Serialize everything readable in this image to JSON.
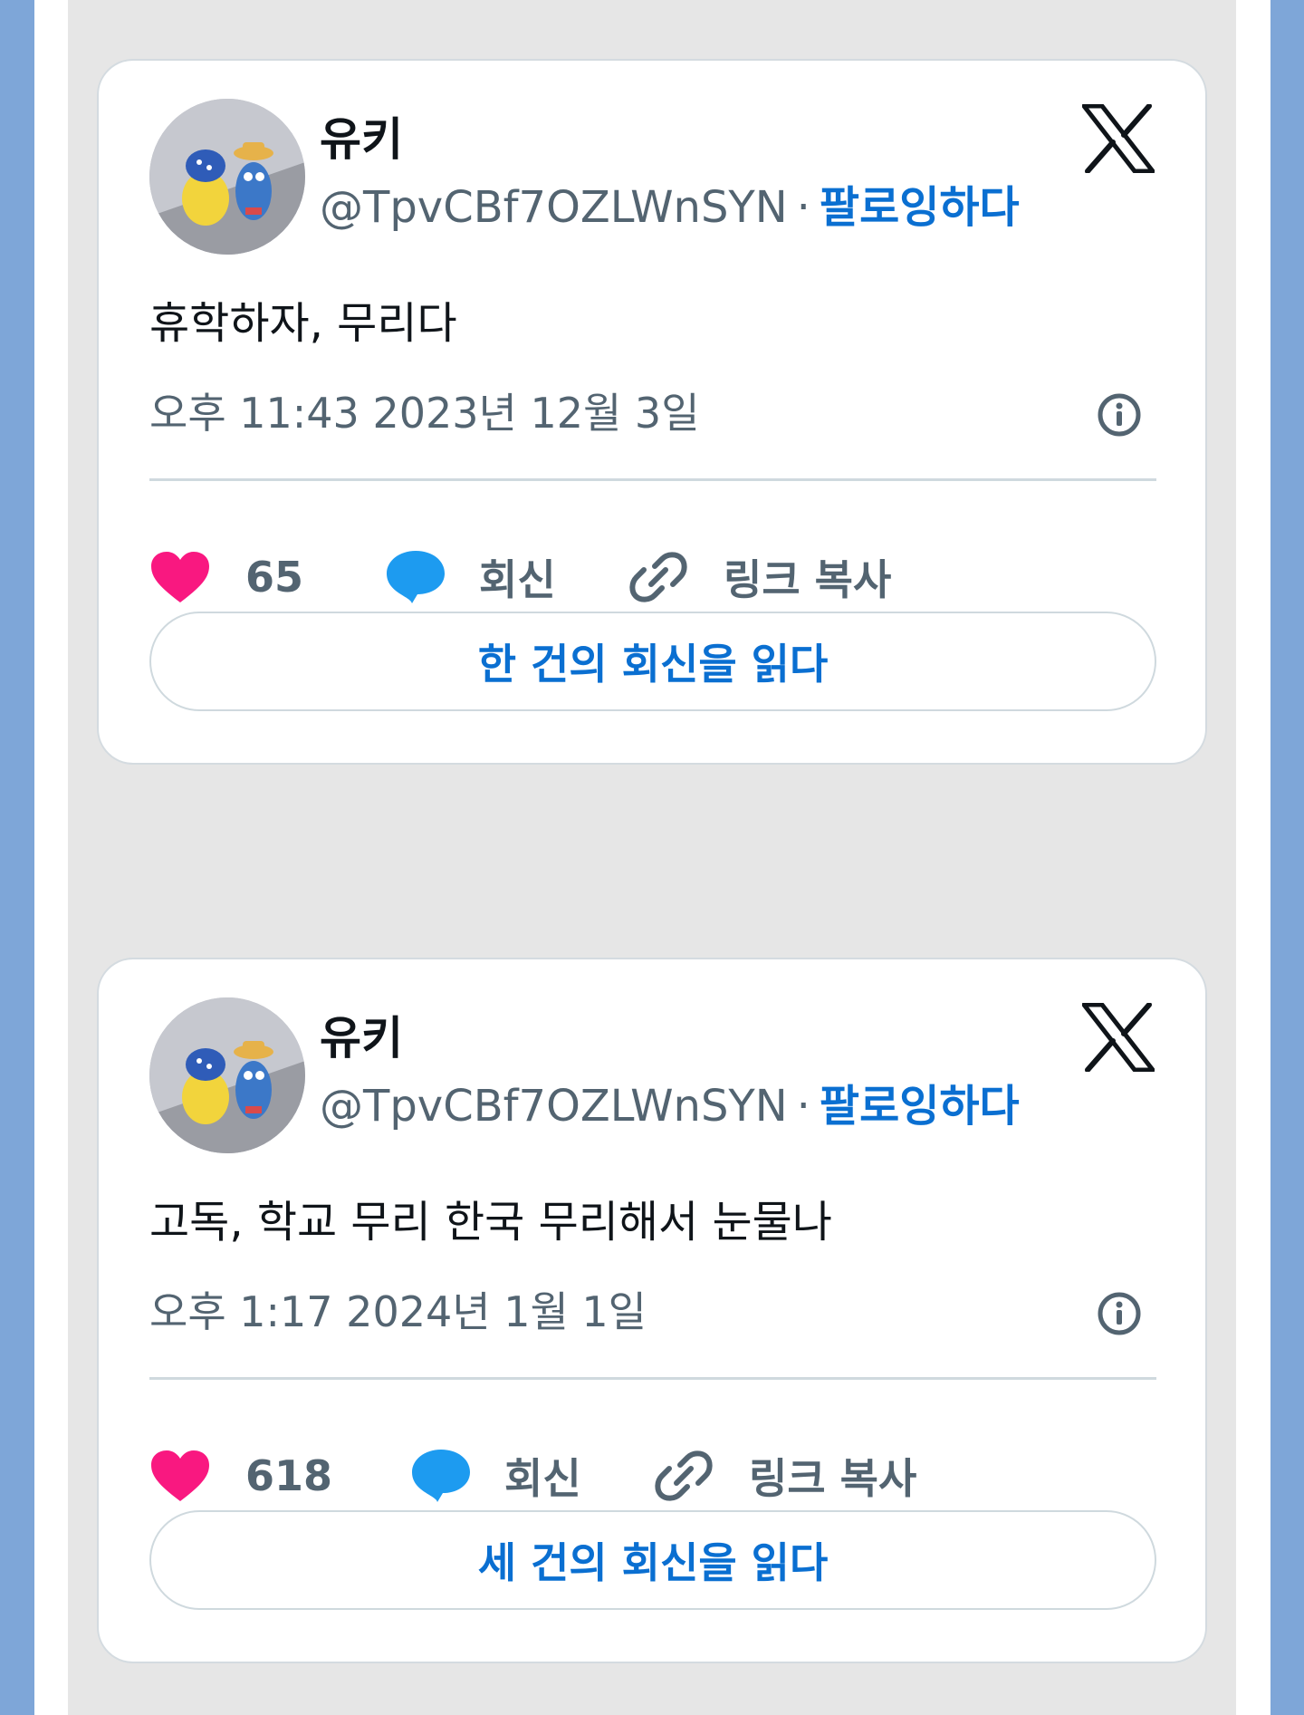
{
  "tweets": [
    {
      "name": "유키",
      "handle": "@TpvCBf7OZLWnSYN",
      "separator": "·",
      "follow_label": "팔로잉하다",
      "text": "휴학하자, 무리다",
      "timestamp": "오후 11:43 2023년 12월 3일",
      "likes": "65",
      "reply_label": "회신",
      "copy_link_label": "링크 복사",
      "read_replies_label": "한 건의 회신을 읽다"
    },
    {
      "name": "유키",
      "handle": "@TpvCBf7OZLWnSYN",
      "separator": "·",
      "follow_label": "팔로잉하다",
      "text": "고독, 학교 무리 한국 무리해서 눈물나",
      "timestamp": "오후 1:17 2024년 1월 1일",
      "likes": "618",
      "reply_label": "회신",
      "copy_link_label": "링크 복사",
      "read_replies_label": "세 건의 회신을 읽다"
    }
  ],
  "colors": {
    "like": "#f91880",
    "reply": "#1d9bf0",
    "accent": "#0a6fd1",
    "muted": "#536471"
  },
  "icons": [
    "avatar-image",
    "x-logo-icon",
    "info-icon",
    "heart-icon",
    "reply-bubble-icon",
    "link-icon"
  ]
}
